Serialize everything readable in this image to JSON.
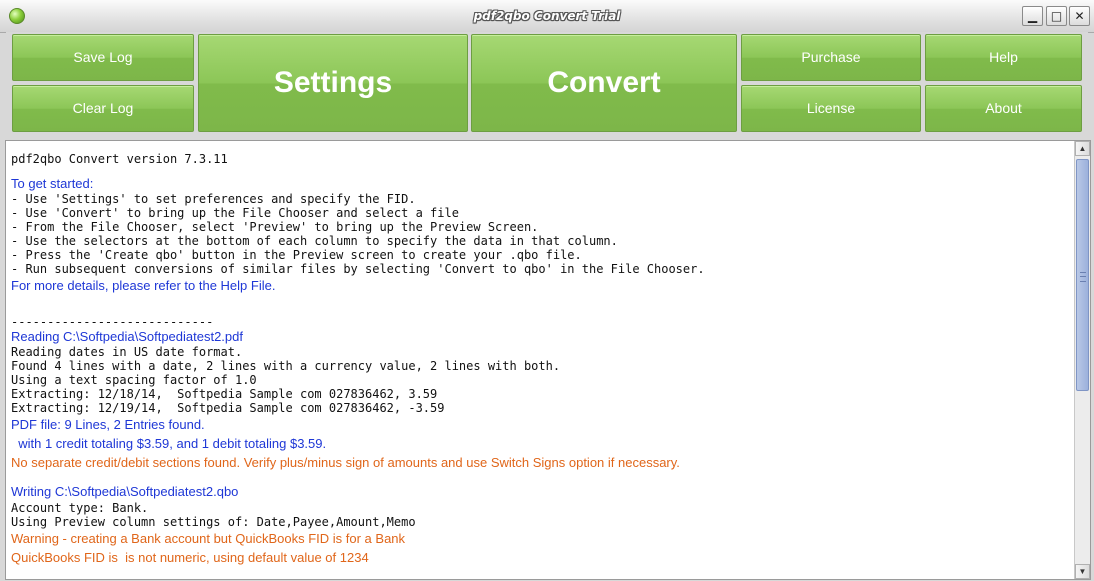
{
  "window": {
    "title": "pdf2qbo Convert Trial",
    "controls": {
      "minimize": "▁",
      "maximize": "□",
      "close": "✕"
    }
  },
  "toolbar": {
    "save_log": "Save Log",
    "clear_log": "Clear Log",
    "settings": "Settings",
    "convert": "Convert",
    "purchase": "Purchase",
    "license": "License",
    "help": "Help",
    "about": "About"
  },
  "log": {
    "version": "pdf2qbo Convert version 7.3.11",
    "get_started": "To get started:",
    "steps": [
      "- Use 'Settings' to set preferences and specify the FID.",
      "- Use 'Convert' to bring up the File Chooser and select a file",
      "- From the File Chooser, select 'Preview' to bring up the Preview Screen.",
      "- Use the selectors at the bottom of each column to specify the data in that column.",
      "- Press the 'Create qbo' button in the Preview screen to create your .qbo file.",
      "- Run subsequent conversions of similar files by selecting 'Convert to qbo' in the File Chooser."
    ],
    "more_details": "For more details, please refer to the Help File.",
    "separator": "----------------------------",
    "reading": "Reading C:\\Softpedia\\Softpediatest2.pdf",
    "reading_lines": [
      "Reading dates in US date format.",
      "Found 4 lines with a date, 2 lines with a currency value, 2 lines with both.",
      "Using a text spacing factor of 1.0",
      "Extracting: 12/18/14,  Softpedia Sample com 027836462, 3.59",
      "Extracting: 12/19/14,  Softpedia Sample com 027836462, -3.59"
    ],
    "pdf_summary": "PDF file: 9 Lines, 2 Entries found.",
    "totals": "  with 1 credit totaling $3.59, and 1 debit totaling $3.59.",
    "no_sections": "No separate credit/debit sections found. Verify plus/minus sign of amounts and use Switch Signs option if necessary.",
    "writing": "Writing C:\\Softpedia\\Softpediatest2.qbo",
    "writing_lines": [
      "Account type: Bank.",
      "Using Preview column settings of: Date,Payee,Amount,Memo"
    ],
    "warning": "Warning - creating a Bank account but QuickBooks FID is for a Bank",
    "fid_note": "QuickBooks FID is  is not numeric, using default value of 1234"
  },
  "scrollbar": {
    "up": "▲",
    "down": "▼"
  },
  "colors": {
    "accent_green": "#8cc657",
    "log_blue": "#1e37d6",
    "log_orange": "#e0661a"
  }
}
